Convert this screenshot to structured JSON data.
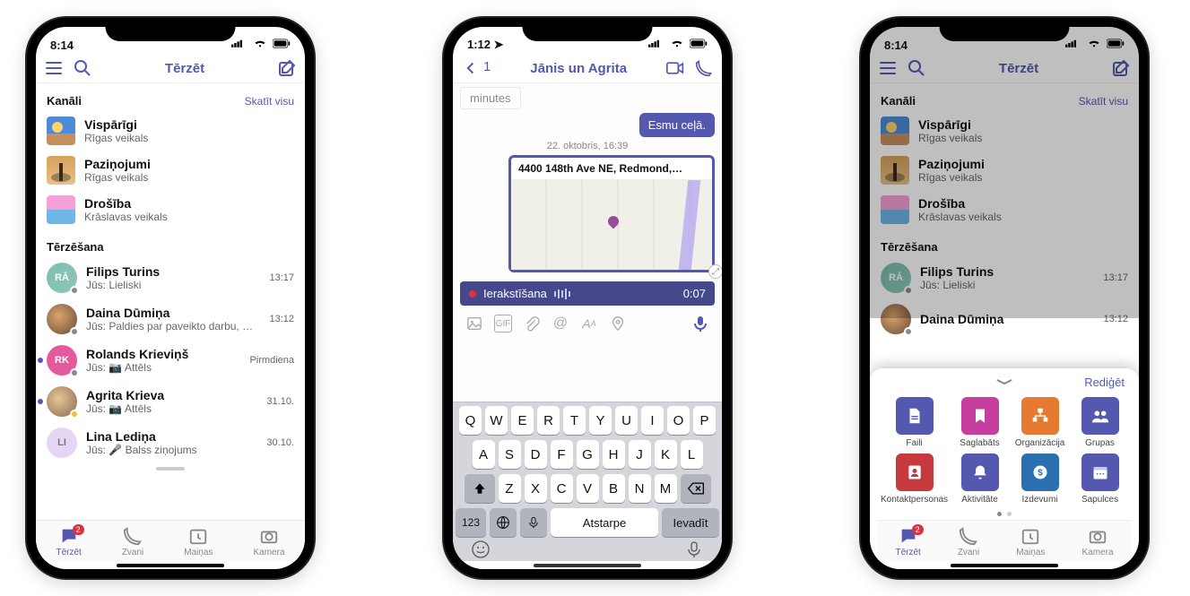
{
  "phone1": {
    "status_time": "8:14",
    "header_title": "Tērzēt",
    "section_channels": "Kanāli",
    "see_all": "Skatīt visu",
    "channels": [
      {
        "name": "Vispārīgi",
        "sub": "Rīgas veikals"
      },
      {
        "name": "Paziņojumi",
        "sub": "Rīgas veikals"
      },
      {
        "name": "Drošība",
        "sub": "Krāslavas veikals"
      }
    ],
    "section_chats": "Tērzēšana",
    "chats": [
      {
        "avatar": "RĀ",
        "name": "Filips Turins",
        "sub": "Jūs: Lieliski",
        "meta": "13:17",
        "bold": false
      },
      {
        "avatar": "",
        "name": "Daina Dūmiņa",
        "sub": "Jūs: Paldies par paveikto darbu, Daina!",
        "meta": "13:12",
        "bold": false
      },
      {
        "avatar": "RK",
        "name": "Rolands Krieviņš",
        "sub": "Jūs: 📷 Attēls",
        "meta": "Pirmdiena",
        "bold": true,
        "dot": true
      },
      {
        "avatar": "",
        "name": "Agrita Krieva",
        "sub": "Jūs: 📷 Attēls",
        "meta": "31.10.",
        "bold": true,
        "dot": true
      },
      {
        "avatar": "LI",
        "name": "Lina Lediņa",
        "sub": "Jūs: 🎤 Balss ziņojums",
        "meta": "30.10.",
        "bold": false
      }
    ],
    "tabs": [
      {
        "label": "Tērzēt",
        "badge": "2",
        "active": true
      },
      {
        "label": "Zvani"
      },
      {
        "label": "Maiņas"
      },
      {
        "label": "Kamera"
      }
    ]
  },
  "phone2": {
    "status_time": "1:12",
    "back_count": "1",
    "header_title": "Jānis un Agrita",
    "half_msg": "minutes",
    "out_msg": "Esmu ceļā.",
    "timestamp": "22. oktobris, 16:39",
    "card_title": "4400 148th Ave NE, Redmond,…",
    "recording_label": "Ierakstīšana",
    "recording_time": "0:07",
    "keyboard": {
      "row1": [
        "Q",
        "W",
        "E",
        "R",
        "T",
        "Y",
        "U",
        "I",
        "O",
        "P"
      ],
      "row2": [
        "A",
        "S",
        "D",
        "F",
        "G",
        "H",
        "J",
        "K",
        "L"
      ],
      "row3": [
        "Z",
        "X",
        "C",
        "V",
        "B",
        "N",
        "M"
      ],
      "num": "123",
      "space": "Atstarpe",
      "enter": "Ievadīt"
    }
  },
  "phone3": {
    "status_time": "8:14",
    "sheet_edit": "Rediģēt",
    "apps": [
      {
        "label": "Faili",
        "color": "c-blue",
        "icon": "file-icon"
      },
      {
        "label": "Saglabāts",
        "color": "c-pink",
        "icon": "bookmark-icon"
      },
      {
        "label": "Organizācija",
        "color": "c-orange",
        "icon": "org-icon"
      },
      {
        "label": "Grupas",
        "color": "c-blue",
        "icon": "people-icon"
      },
      {
        "label": "Kontaktpersonas",
        "color": "c-red",
        "icon": "contact-icon"
      },
      {
        "label": "Aktivitāte",
        "color": "c-blue",
        "icon": "bell-icon"
      },
      {
        "label": "Izdevumi",
        "color": "c-dblue",
        "icon": "coin-icon"
      },
      {
        "label": "Sapulces",
        "color": "c-blue",
        "icon": "calendar-icon"
      }
    ]
  }
}
